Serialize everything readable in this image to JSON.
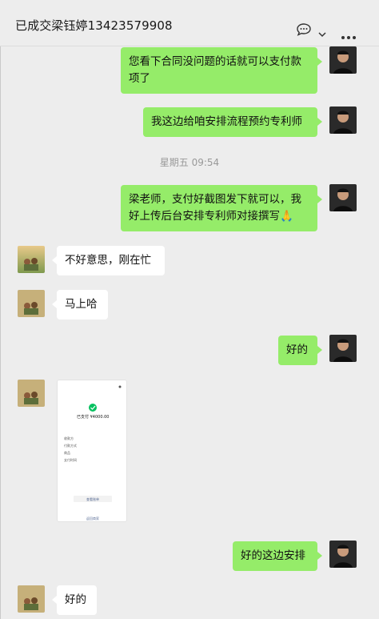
{
  "window": {
    "pin_icon": "pin-icon",
    "minimize_icon": "minimize-icon",
    "maximize_icon": "maximize-icon",
    "close_icon": "close-icon"
  },
  "header": {
    "title": "已成交梁钰婷13423579908",
    "chat_icon": "chat-bubble-icon",
    "dropdown_icon": "chevron-down-icon",
    "more_icon": "more-icon"
  },
  "messages": [
    {
      "side": "me",
      "text_lines": [
        "您看下合同没问题的话就可以支付款",
        "项了"
      ]
    },
    {
      "side": "me",
      "text_lines": [
        "我这边给咱安排流程预约专利师"
      ]
    },
    {
      "timestamp": "星期五 09:54"
    },
    {
      "side": "me",
      "text_lines": [
        "梁老师，支付好截图发下就可以，我",
        "好上传后台安排专利师对接撰写"
      ],
      "emoji": "🙏"
    },
    {
      "side": "other",
      "text_lines": [
        "不好意思，刚在忙"
      ]
    },
    {
      "side": "other",
      "text_lines": [
        "马上哈"
      ]
    },
    {
      "side": "me",
      "text_lines": [
        "好的"
      ]
    },
    {
      "side": "other",
      "image": {
        "amount": "已支付 ¥4000.00",
        "rows": [
          "收款方",
          "付款方式",
          "商品",
          "支付时间"
        ],
        "button": "查看账单",
        "footer": "返回商家"
      }
    },
    {
      "side": "me",
      "text_lines": [
        "好的这边安排"
      ]
    },
    {
      "side": "other",
      "text_lines": [
        "好的"
      ]
    }
  ]
}
